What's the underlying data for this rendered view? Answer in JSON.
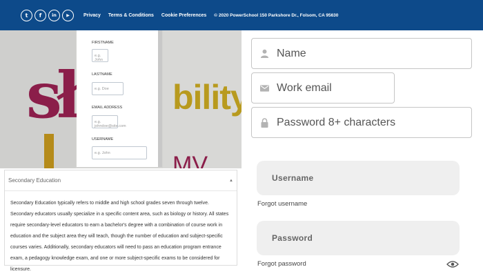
{
  "footer": {
    "social": [
      {
        "name": "twitter",
        "glyph": "t"
      },
      {
        "name": "facebook",
        "glyph": "f"
      },
      {
        "name": "linkedin",
        "glyph": "in"
      },
      {
        "name": "youtube",
        "glyph": "▶"
      }
    ],
    "links": [
      "Privacy",
      "Terms & Conditions",
      "Cookie Preferences"
    ],
    "copyright": "© 2020 PowerSchool 150 Parkshore Dr., Folsom, CA 95630",
    "color": "#0d4a8a"
  },
  "background": {
    "logo_left": "sła",
    "logo_right": "bility",
    "logo_bottom": "MV"
  },
  "profile_form": {
    "fields": [
      {
        "label": "FIRSTNAME",
        "placeholder": "e.g. John"
      },
      {
        "label": "LASTNAME",
        "placeholder": "e.g. Doe"
      },
      {
        "label": "EMAIL ADDRESS",
        "placeholder": "e.g. johndoe@site.com"
      },
      {
        "label": "USERNAME",
        "placeholder": "e.g. John"
      }
    ]
  },
  "accordion": {
    "title": "Secondary Education",
    "caret": "▲",
    "body": "Secondary Education typically refers to middle and high school grades seven through twelve. Secondary educators usually specialize in a specific content area, such as biology or history. All states require secondary-level educators to earn a bachelor's degree with a combination of course work in education and the subject area they will teach, though the number of education and subject-specific courses varies. Additionally, secondary educators will need to pass an education program entrance exam, a pedagogy knowledge exam, and one or more subject-specific exams to be considered for licensure."
  },
  "signup": {
    "name_placeholder": "Name",
    "email_placeholder": "Work email",
    "password_placeholder": "Password 8+ characters"
  },
  "login": {
    "username_placeholder": "Username",
    "forgot_username": "Forgot username",
    "password_placeholder": "Password",
    "forgot_password": "Forgot password"
  }
}
